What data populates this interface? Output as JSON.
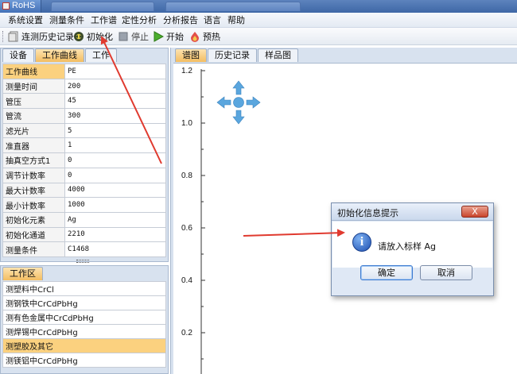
{
  "window": {
    "title": "RoHS"
  },
  "menu": [
    "系统设置",
    "测量条件",
    "工作谱",
    "定性分析",
    "分析报告",
    "语言",
    "帮助"
  ],
  "toolbar": {
    "history": "连测历史记录",
    "init": "初始化",
    "stop": "停止",
    "start": "开始",
    "preheat": "预热"
  },
  "left_tabs": [
    "设备",
    "工作曲线",
    "工作"
  ],
  "properties": [
    {
      "key": "工作曲线",
      "value": "PE"
    },
    {
      "key": "测量时间",
      "value": "200"
    },
    {
      "key": "管压",
      "value": "45"
    },
    {
      "key": "管流",
      "value": "300"
    },
    {
      "key": "滤光片",
      "value": "5"
    },
    {
      "key": "准直器",
      "value": "1"
    },
    {
      "key": "抽真空方式1",
      "value": "0"
    },
    {
      "key": "调节计数率",
      "value": "0"
    },
    {
      "key": "最大计数率",
      "value": "4000"
    },
    {
      "key": "最小计数率",
      "value": "1000"
    },
    {
      "key": "初始化元素",
      "value": "Ag"
    },
    {
      "key": "初始化通道",
      "value": "2210"
    },
    {
      "key": "测量条件",
      "value": "C1468"
    }
  ],
  "work_area": {
    "tab": "工作区",
    "items": [
      "测塑料中CrCl",
      "测钢铁中CrCdPbHg",
      "测有色金属中CrCdPbHg",
      "测焊锡中CrCdPbHg",
      "测塑胶及其它",
      "测镁铝中CrCdPbHg"
    ]
  },
  "right_tabs": [
    "谱图",
    "历史记录",
    "样品图"
  ],
  "y_ticks": [
    "1.2",
    "1.0",
    "0.8",
    "0.6",
    "0.4",
    "0.2"
  ],
  "dialog": {
    "title": "初始化信息提示",
    "close": "X",
    "message": "请放入标样 Ag",
    "ok": "确定",
    "cancel": "取消"
  },
  "colors": {
    "annotation_arrow": "#e03a2f",
    "selected_row": "#fbd17f"
  }
}
